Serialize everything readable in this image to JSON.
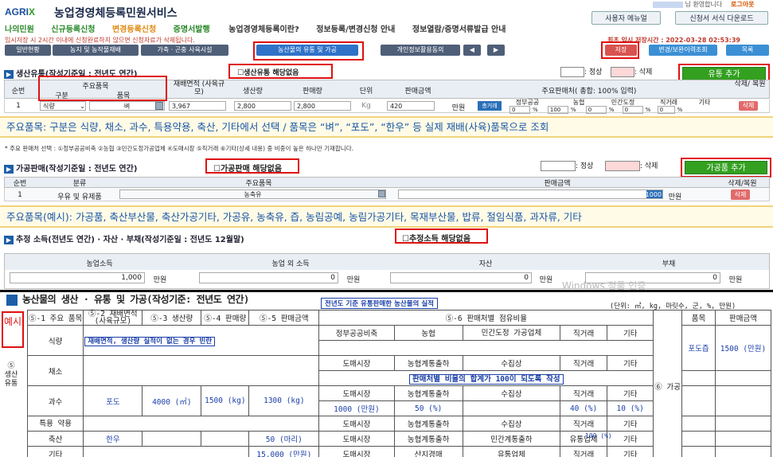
{
  "header": {
    "logo": "AGRIX",
    "title": "농업경영체등록민원서비스",
    "greeting": "님 환영합니다",
    "logout": "로그아웃",
    "user_manual": "사용자 메뉴얼",
    "download": "신청서 서식 다운로드"
  },
  "menu": [
    "나의민원",
    "신규등록신청",
    "변경등록신청",
    "증명서발행",
    "농업경영체등록이란?",
    "정보등록/변경신청 안내",
    "정보열람/증명서류발급 안내"
  ],
  "notice": "임시저장 시 2시간 이내에 신청완료하지 않으면 신청자료가 삭제됩니다.",
  "save_time": "최초 임시 저장시간 : 2022-03-28 02:53:39",
  "nav": {
    "items": [
      "일반현황",
      "농지 및 농작물재배",
      "가축 · 곤충 사육시설",
      "농산물의 유통 및 가공",
      "개인정보활용동의"
    ],
    "save": "저장",
    "history": "변경/보완이력조회",
    "list": "목록"
  },
  "sec1": {
    "title": "생산유통(작성기준일 : 전년도 연간)",
    "no_dist": "생산유통 해당없음",
    "legend_normal": ": 정상",
    "legend_delete": ": 삭제",
    "add": "유통 추가",
    "headers": {
      "no": "순번",
      "item": "주요품목",
      "type": "구분",
      "name": "품목",
      "area": "재배면적 (사육규모)",
      "prod": "생산량",
      "sales": "판매량",
      "unit": "단위",
      "amount": "판매금액",
      "dist": "주요판매처( 총합: 100% 입력)",
      "restore": "삭제/ 복원"
    },
    "row": {
      "no": "1",
      "type": "식량",
      "name": "벼",
      "area": "3,967",
      "prod": "2,800",
      "sales": "2,800",
      "unit": "Kg",
      "amount": "420",
      "won": "만원",
      "direct": "총거래",
      "ch1": "정부공공",
      "ch2": "농협",
      "ch3": "민간도정",
      "ch4": "직거래",
      "ch5": "기타",
      "v1": "0",
      "v2": "100",
      "v3": "0",
      "v4": "0",
      "v5": "0",
      "pct": "%",
      "del": "삭제"
    }
  },
  "note1": "주요품목: 구분은 식량, 채소, 과수, 특용약용, 축산, 기타에서 선택 / 품목은 “벼”, “포도”, “한우” 등 실제  재배(사육)품목으로 조회",
  "sec1_footnote": "* 주요 판매처 선택 : ①정부공공비축 ②농협 ③민간도정가공업체 ④도매시장 ⑤직거래 ⑥기타(상세 내용) 중 비중이 높은 하나만 기재합니다.",
  "sec2": {
    "title": "가공판매(작성기준일 : 전년도 연간)",
    "no_proc": "가공판매 해당없음",
    "legend_normal": ": 정상",
    "legend_delete": ": 삭제",
    "add": "가공품 추가",
    "headers": {
      "no": "순번",
      "cat": "분류",
      "item": "주요품목",
      "amount": "판매금액",
      "restore": "삭제/복원"
    },
    "row": {
      "no": "1",
      "cat": "우유 및 유제품",
      "item": "농축유",
      "amount": "1000",
      "won": "만원",
      "del": "삭제"
    }
  },
  "note2": "주요품목(예시): 가공품, 축산부산물, 축산가공기타, 가공유, 농축유, 즙, 농림공예, 농림가공기타, 목재부산물, 밥류, 절임식품, 과자류, 기타",
  "sec3": {
    "title": "추정 소득(전년도 연간) · 자산 · 부채(작성기준일 : 전년도 12월말)",
    "no_income": "추정소득 해당없음",
    "cols": [
      "농업소득",
      "농업 외 소득",
      "자산",
      "부채"
    ],
    "vals": [
      "1,000",
      "0",
      "0",
      "0"
    ],
    "won": "만원",
    "watermark": "Windows 정품 인증"
  },
  "sheet": {
    "title": "농산물의 생산 · 유통 및 가공(작성기준: 전년도 연간)",
    "sub": "전년도 기준 유통판매한 농산물의 실적",
    "units": "(단위: ㎡, kg, 마릿수, 군, %, 만원)",
    "ex": "예시",
    "side": "⑤ 생산 유통",
    "proc_label": "⑥ 가공",
    "h": [
      "⑤-1 주요 품목",
      "⑤-2 재배면적 (사육규모)",
      "⑤-3 생산량",
      "⑤-4 판매량",
      "⑤-5 판매금액",
      "⑤-6 판매처별 점유비율",
      "품목",
      "판매금액"
    ],
    "rows": [
      "식량",
      "채소",
      "과수",
      "특용 약용",
      "축산",
      "기타"
    ],
    "food_note": "재배면적, 생산량 실적이 없는 경우 빈란",
    "grape": {
      "item": "포도",
      "area": "4000 (㎡)",
      "prod": "1500 (kg)",
      "sales": "1300 (kg)",
      "amt": "1000 (만원)"
    },
    "cow": {
      "item": "한우",
      "sales": "50 (마리)",
      "amt": "15,000 (만원)"
    },
    "proc": {
      "item": "포도즙",
      "amt": "1500 (만원)"
    },
    "ch": [
      [
        "정부공공비축",
        "농협",
        "민간도정 가공업체",
        "직거래",
        "기타"
      ],
      [
        "도매시장",
        "농협계통출하",
        "수집상",
        "직거래",
        "기타"
      ],
      [
        "판매처별 비율의 합계가 100이 되도록 작성"
      ],
      [
        "도매시장",
        "농협계통출하",
        "수집상",
        "직거래",
        "기타"
      ],
      [
        "50 (%)",
        "40 (%)",
        "10 (%)"
      ],
      [
        "도매시장",
        "농협계통출하",
        "수집상",
        "직거래",
        "기타"
      ],
      [
        "도매시장",
        "농협계통출하",
        "민간계통출하",
        "유통업체",
        "기타"
      ],
      [
        "100 (%)"
      ],
      [
        "도매시장",
        "산지경매",
        "유통업체",
        "직거래",
        "기타"
      ]
    ]
  }
}
